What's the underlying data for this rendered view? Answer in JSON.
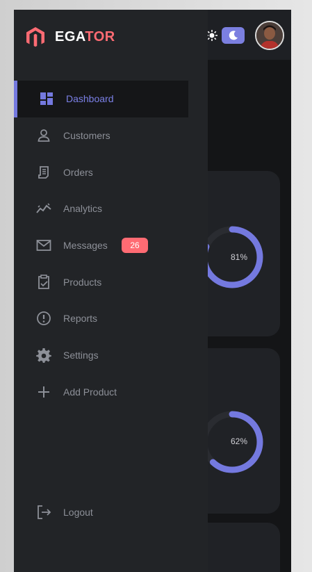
{
  "brand": {
    "name_part1": "EGA",
    "name_part2": "TOR",
    "accent_color": "#ff6b73"
  },
  "header": {
    "icons": [
      "compress-icon",
      "sun-icon",
      "moon-icon"
    ],
    "toggle_color": "#7b7fe0"
  },
  "sidebar": {
    "active_color": "#7b80e6",
    "items": [
      {
        "label": "Dashboard",
        "icon": "dashboard-icon",
        "active": true
      },
      {
        "label": "Customers",
        "icon": "person-icon"
      },
      {
        "label": "Orders",
        "icon": "receipt-icon"
      },
      {
        "label": "Analytics",
        "icon": "analytics-icon"
      },
      {
        "label": "Messages",
        "icon": "mail-icon",
        "badge": "26"
      },
      {
        "label": "Products",
        "icon": "clipboard-icon"
      },
      {
        "label": "Reports",
        "icon": "info-icon"
      },
      {
        "label": "Settings",
        "icon": "gear-icon"
      },
      {
        "label": "Add Product",
        "icon": "plus-icon"
      }
    ],
    "logout_label": "Logout"
  },
  "main": {
    "cards": [
      {
        "percent_label": "81%",
        "percent": 81
      },
      {
        "percent_label": "62%",
        "percent": 62
      }
    ]
  }
}
